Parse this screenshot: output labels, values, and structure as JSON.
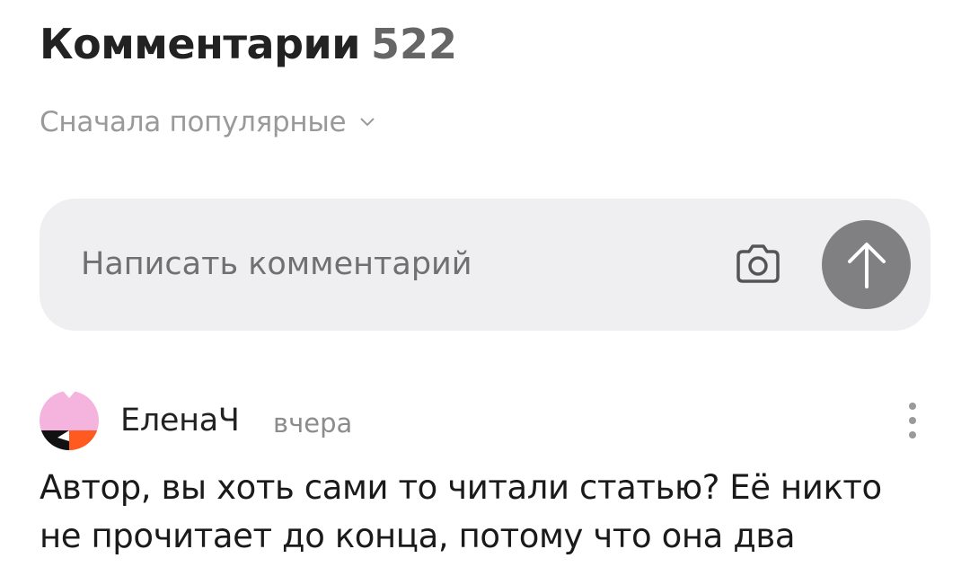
{
  "header": {
    "title": "Комментарии",
    "count": "522"
  },
  "sort": {
    "label": "Сначала популярные",
    "icon": "chevron-down-icon"
  },
  "composer": {
    "placeholder": "Написать комментарий",
    "camera_icon": "camera-icon",
    "send_icon": "arrow-up-icon"
  },
  "comments": [
    {
      "author": "ЕленаЧ",
      "time": "вчера",
      "text_line1": "Автор, вы хоть сами то читали статью? Её никто",
      "text_line2": "не прочитает до конца, потому что она два",
      "more_icon": "more-vertical-icon"
    }
  ],
  "colors": {
    "composer_bg": "#efeff1",
    "send_button": "#808082",
    "muted_text": "#9a9a9a"
  }
}
